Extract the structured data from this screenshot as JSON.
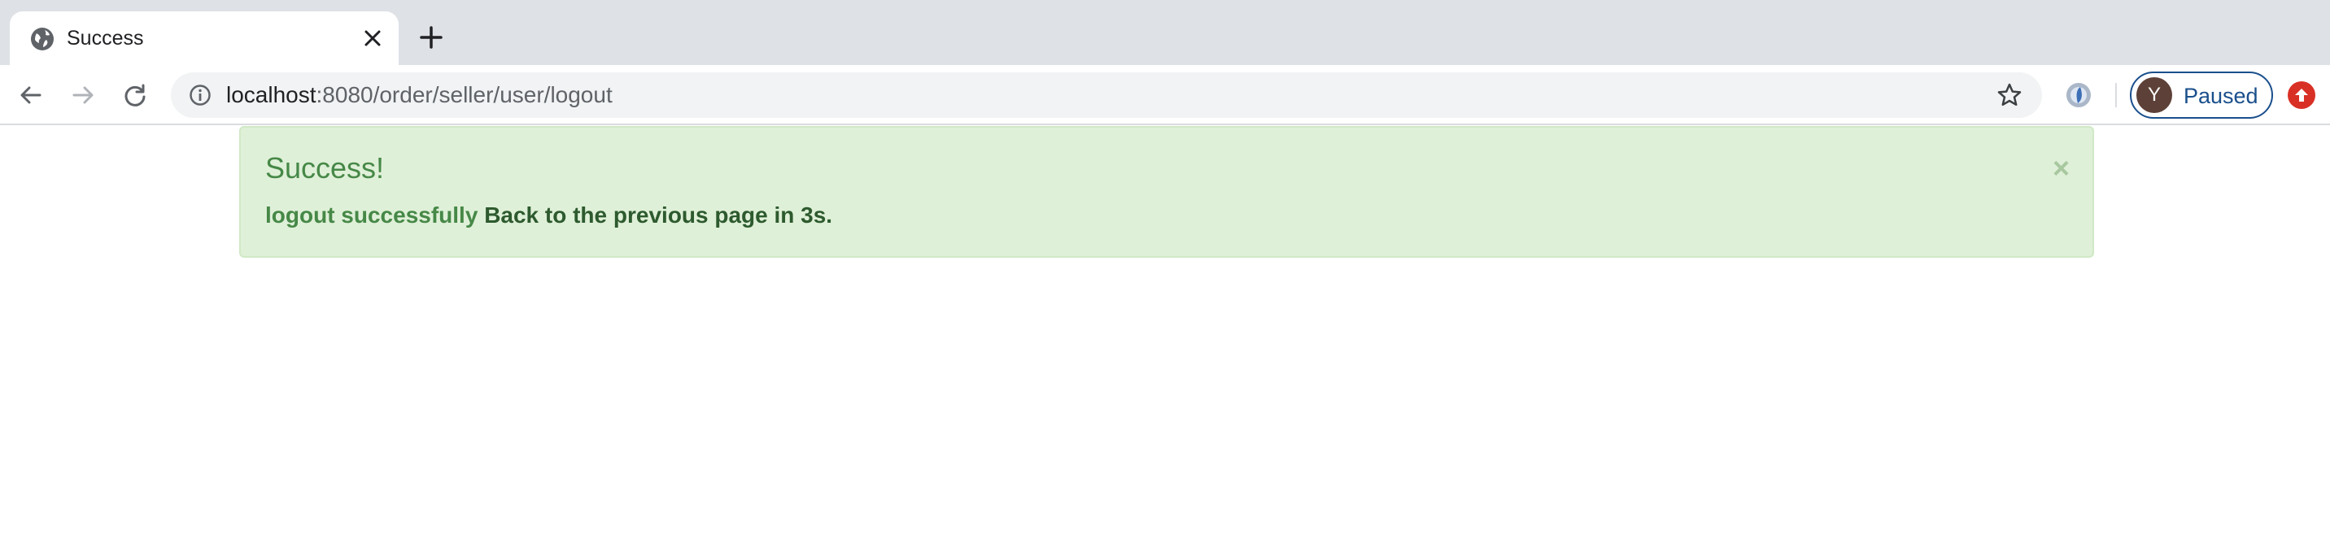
{
  "browser": {
    "tab": {
      "title": "Success",
      "favicon": "globe-icon",
      "close_icon": "close-icon"
    },
    "new_tab_icon": "plus-icon",
    "toolbar": {
      "back_icon": "arrow-left-icon",
      "forward_icon": "arrow-right-icon",
      "reload_icon": "reload-icon",
      "url_host": "localhost",
      "url_rest": ":8080/order/seller/user/logout",
      "site_info_icon": "info-icon",
      "bookmark_icon": "star-icon",
      "extension_icon": "extension-icon",
      "profile": {
        "initial": "Y",
        "label": "Paused",
        "avatar_color": "#5d4037",
        "accent": "#1a4f8c"
      },
      "update_icon": "update-arrow-icon",
      "update_color": "#d93025"
    }
  },
  "alert": {
    "heading": "Success!",
    "message": "logout successfully",
    "strong": "Back to the previous page in 3s.",
    "close": "×",
    "colors": {
      "background": "#dff0d8",
      "border": "#d0e9c6",
      "text": "#3c763d"
    }
  }
}
